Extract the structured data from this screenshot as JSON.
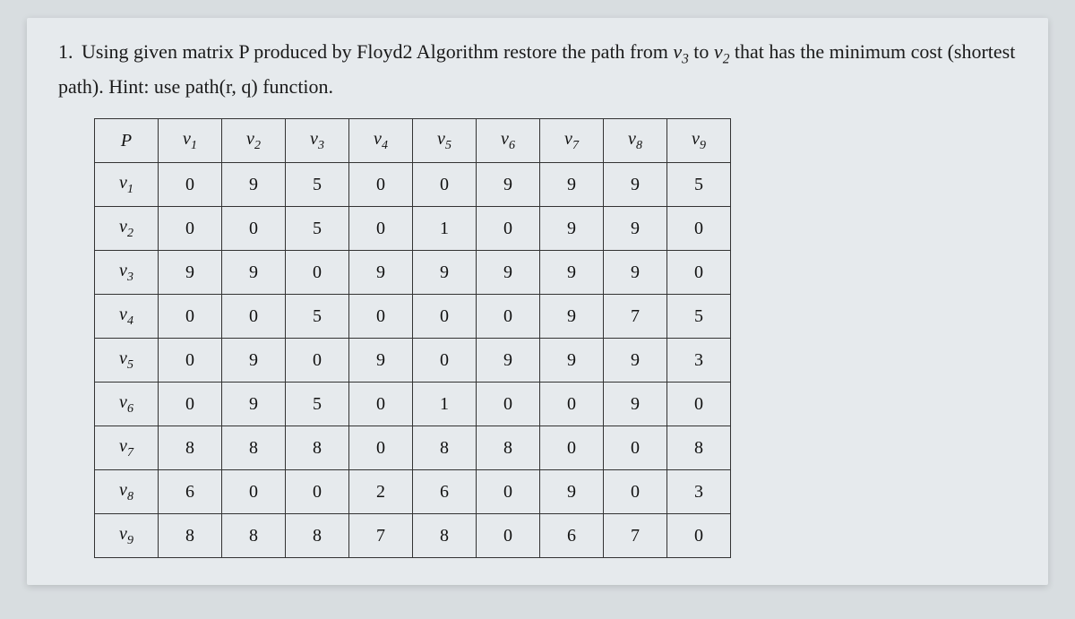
{
  "question": {
    "number": "1.",
    "text_before_P": "Using given matrix ",
    "P": "P",
    "text_after_P": " produced by Floyd2 Algorithm restore the path from ",
    "v3": "v",
    "v3_sub": "3",
    "mid": " to ",
    "v2": "v",
    "v2_sub": "2",
    "text_end": " that has the minimum cost (shortest path). Hint: use path(r, q) function."
  },
  "table": {
    "corner": "P",
    "col_headers": [
      "v1",
      "v2",
      "v3",
      "v4",
      "v5",
      "v6",
      "v7",
      "v8",
      "v9"
    ],
    "row_headers": [
      "v1",
      "v2",
      "v3",
      "v4",
      "v5",
      "v6",
      "v7",
      "v8",
      "v9"
    ],
    "rows": [
      [
        "0",
        "9",
        "5",
        "0",
        "0",
        "9",
        "9",
        "9",
        "5"
      ],
      [
        "0",
        "0",
        "5",
        "0",
        "1",
        "0",
        "9",
        "9",
        "0"
      ],
      [
        "9",
        "9",
        "0",
        "9",
        "9",
        "9",
        "9",
        "9",
        "0"
      ],
      [
        "0",
        "0",
        "5",
        "0",
        "0",
        "0",
        "9",
        "7",
        "5"
      ],
      [
        "0",
        "9",
        "0",
        "9",
        "0",
        "9",
        "9",
        "9",
        "3"
      ],
      [
        "0",
        "9",
        "5",
        "0",
        "1",
        "0",
        "0",
        "9",
        "0"
      ],
      [
        "8",
        "8",
        "8",
        "0",
        "8",
        "8",
        "0",
        "0",
        "8"
      ],
      [
        "6",
        "0",
        "0",
        "2",
        "6",
        "0",
        "9",
        "0",
        "3"
      ],
      [
        "8",
        "8",
        "8",
        "7",
        "8",
        "0",
        "6",
        "7",
        "0"
      ]
    ]
  },
  "chart_data": {
    "type": "table",
    "title": "Floyd2 P matrix",
    "columns": [
      "v1",
      "v2",
      "v3",
      "v4",
      "v5",
      "v6",
      "v7",
      "v8",
      "v9"
    ],
    "rows": [
      "v1",
      "v2",
      "v3",
      "v4",
      "v5",
      "v6",
      "v7",
      "v8",
      "v9"
    ],
    "values": [
      [
        0,
        9,
        5,
        0,
        0,
        9,
        9,
        9,
        5
      ],
      [
        0,
        0,
        5,
        0,
        1,
        0,
        9,
        9,
        0
      ],
      [
        9,
        9,
        0,
        9,
        9,
        9,
        9,
        9,
        0
      ],
      [
        0,
        0,
        5,
        0,
        0,
        0,
        9,
        7,
        5
      ],
      [
        0,
        9,
        0,
        9,
        0,
        9,
        9,
        9,
        3
      ],
      [
        0,
        9,
        5,
        0,
        1,
        0,
        0,
        9,
        0
      ],
      [
        8,
        8,
        8,
        0,
        8,
        8,
        0,
        0,
        8
      ],
      [
        6,
        0,
        0,
        2,
        6,
        0,
        9,
        0,
        3
      ],
      [
        8,
        8,
        8,
        7,
        8,
        0,
        6,
        7,
        0
      ]
    ]
  }
}
